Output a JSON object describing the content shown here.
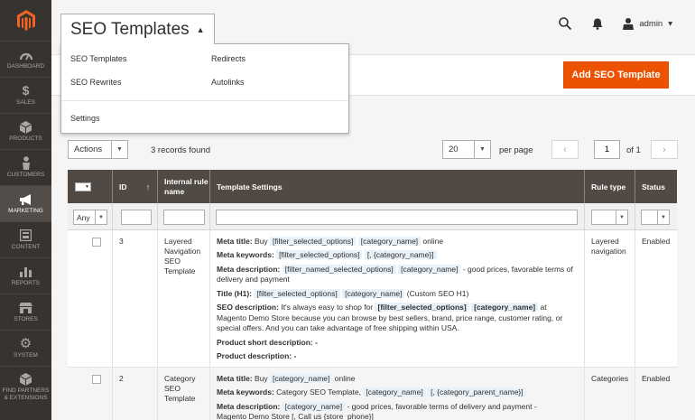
{
  "sidebar": {
    "items": [
      {
        "label": "DASHBOARD",
        "icon": "dashboard-icon"
      },
      {
        "label": "SALES",
        "icon": "dollar-icon"
      },
      {
        "label": "PRODUCTS",
        "icon": "cube-icon"
      },
      {
        "label": "CUSTOMERS",
        "icon": "person-icon"
      },
      {
        "label": "MARKETING",
        "icon": "megaphone-icon"
      },
      {
        "label": "CONTENT",
        "icon": "content-icon"
      },
      {
        "label": "REPORTS",
        "icon": "bar-chart-icon"
      },
      {
        "label": "STORES",
        "icon": "store-icon"
      },
      {
        "label": "SYSTEM",
        "icon": "gear-icon"
      },
      {
        "label": "FIND PARTNERS & EXTENSIONS",
        "icon": "box-icon"
      }
    ],
    "active": "MARKETING"
  },
  "header": {
    "title": "SEO Templates",
    "admin_label": "admin",
    "admin_caret": "▾",
    "title_caret": "▲"
  },
  "dropdown": {
    "col1": [
      "SEO Templates",
      "SEO Rewrites",
      "Settings"
    ],
    "col2": [
      "Redirects",
      "Autolinks"
    ]
  },
  "page_actions": {
    "add_button": "Add SEO Template"
  },
  "toolbar": {
    "actions_label": "Actions",
    "records": "3 records found",
    "per_page_value": "20",
    "per_page_label": "per page",
    "current_page": "1",
    "of_pages": "of 1"
  },
  "grid": {
    "columns": {
      "id": "ID",
      "sort_arrow": "↑",
      "internal": "Internal rule name",
      "settings": "Template Settings",
      "rule_type": "Rule type",
      "status": "Status"
    },
    "filter_any": "Any",
    "rows": [
      {
        "id": "3",
        "name": "Layered Navigation SEO Template",
        "rule_type": "Layered navigation",
        "status": "Enabled"
      },
      {
        "id": "2",
        "name": "Category SEO Template",
        "rule_type": "Categories",
        "status": "Enabled"
      }
    ],
    "row1_settings": {
      "meta_title_label": "Meta title:",
      "meta_title_pre": " Buy ",
      "meta_title_t1": "[filter_selected_options]",
      "meta_title_t2": "[category_name]",
      "meta_title_post": " online",
      "meta_kw_label": "Meta keywords:",
      "meta_kw_t1": "[filter_selected_options]",
      "meta_kw_t2": "[, {category_name}]",
      "meta_desc_label": "Meta description:",
      "meta_desc_t1": "[filter_named_selected_options]",
      "meta_desc_t2": "[category_name]",
      "meta_desc_post": " - good prices, favorable terms of delivery and payment",
      "h1_label": "Title (H1):",
      "h1_t1": "[filter_selected_options]",
      "h1_t2": "[category_name]",
      "h1_post": " (Custom SEO H1)",
      "seo_desc_label": "SEO description:",
      "seo_desc_pre": " It's always easy to shop for ",
      "seo_desc_t1": "[filter_selected_options]",
      "seo_desc_t2": "[category_name]",
      "seo_desc_post": " at Magento Demo Store because you can browse by best sellers, brand, price range, customer rating, or special offers. And you can take advantage of free shipping within USA.",
      "short_desc": "Product short description: -",
      "prod_desc": "Product description: -"
    },
    "row2_settings": {
      "meta_title_label": "Meta title:",
      "meta_title_pre": " Buy ",
      "meta_title_t1": "[category_name]",
      "meta_title_post": " online",
      "meta_kw_label": "Meta keywords:",
      "meta_kw_pre": " Category SEO Template, ",
      "meta_kw_t1": "[category_name]",
      "meta_kw_t2": "[, {category_parent_name}]",
      "meta_desc_label": "Meta description:",
      "meta_desc_t1": "[category_name]",
      "meta_desc_post": " - good prices, favorable terms of delivery and payment -",
      "meta_desc_line2": "Magento Demo Store [, Call us {store_phone}]"
    }
  },
  "colors": {
    "accent": "#eb5202",
    "sidebar": "#373330",
    "grid_header": "#514943"
  }
}
